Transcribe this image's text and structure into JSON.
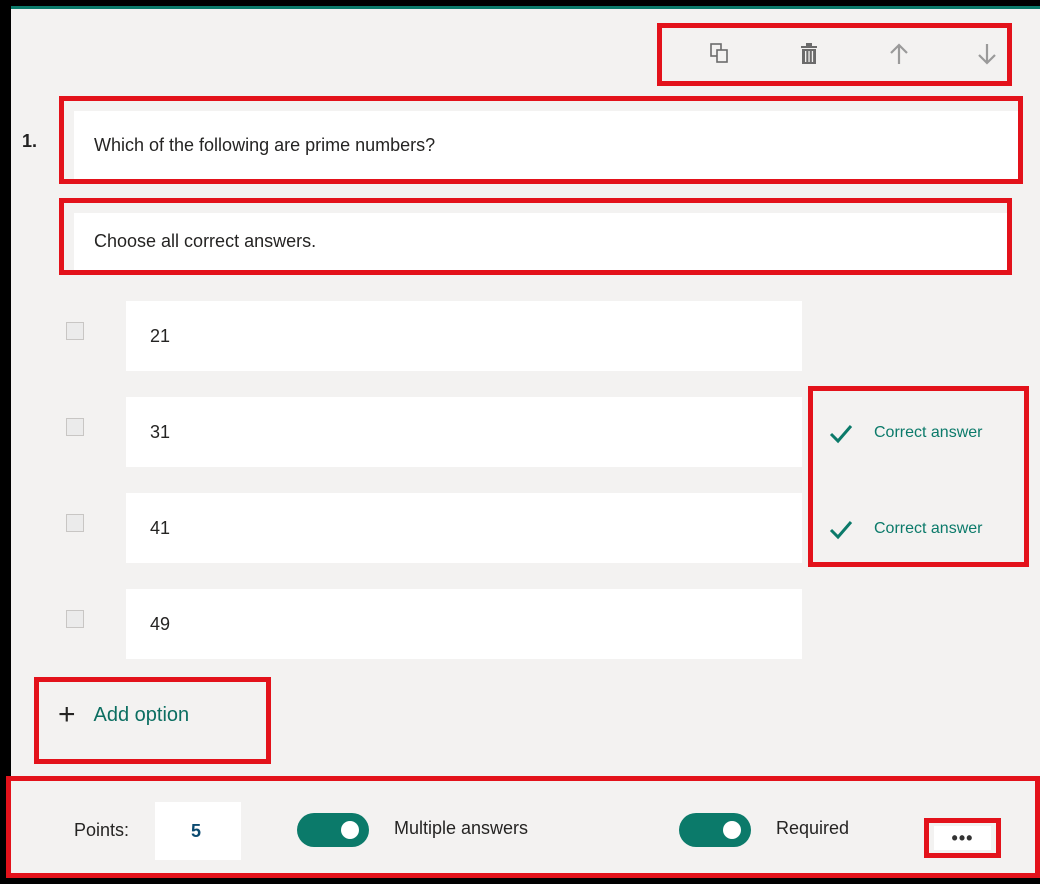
{
  "question": {
    "number": "1.",
    "title": "Which of the following are prime numbers?",
    "subtitle": "Choose all correct answers."
  },
  "toolbar": {
    "icons": [
      "copy-icon",
      "delete-icon",
      "move-up-icon",
      "move-down-icon"
    ]
  },
  "options": [
    {
      "value": "21",
      "correct": false
    },
    {
      "value": "31",
      "correct": true
    },
    {
      "value": "41",
      "correct": true
    },
    {
      "value": "49",
      "correct": false
    }
  ],
  "correct_label": "Correct answer",
  "add_option_label": "Add option",
  "footer": {
    "points_label": "Points:",
    "points_value": "5",
    "multiple_answers_label": "Multiple answers",
    "multiple_answers_on": true,
    "required_label": "Required",
    "required_on": true,
    "more_label": "•••"
  },
  "colors": {
    "accent": "#0b7a6a",
    "highlight": "#e3121b",
    "background": "#f3f2f1"
  }
}
